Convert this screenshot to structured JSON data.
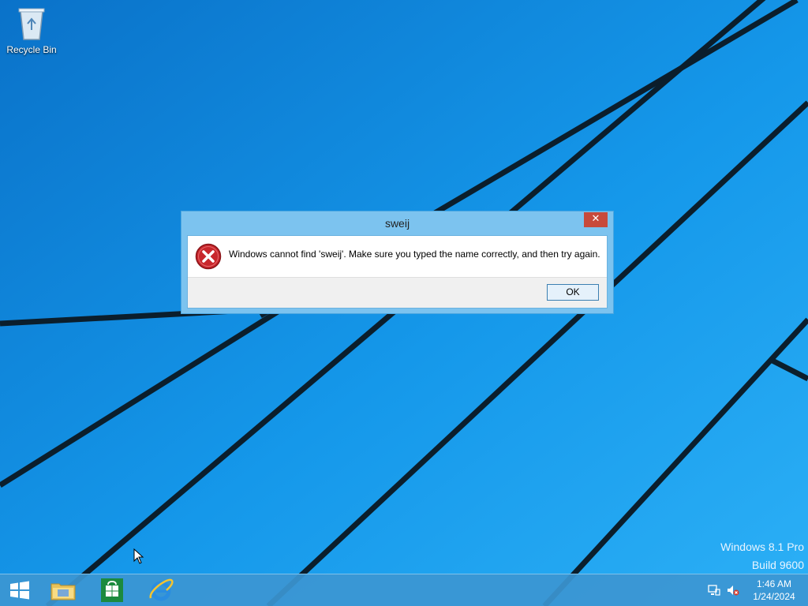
{
  "desktop": {
    "icons": [
      {
        "label": "Recycle Bin",
        "icon": "recycle-bin-icon"
      }
    ],
    "watermark": {
      "line1": "Windows 8.1 Pro",
      "line2": "Build 9600"
    }
  },
  "dialog": {
    "title": "sweij",
    "close_label": "✕",
    "icon": "error-icon",
    "message": "Windows cannot find 'sweij'. Make sure you typed the name correctly, and then try again.",
    "ok_label": "OK"
  },
  "taskbar": {
    "pinned": [
      {
        "name": "start",
        "icon": "windows-logo-icon"
      },
      {
        "name": "file-explorer",
        "icon": "folder-icon"
      },
      {
        "name": "store",
        "icon": "store-icon"
      },
      {
        "name": "internet-explorer",
        "icon": "ie-icon"
      }
    ],
    "tray": [
      {
        "icon": "network-icon"
      },
      {
        "icon": "volume-muted-icon"
      }
    ],
    "clock": {
      "time": "1:46 AM",
      "date": "1/24/2024"
    }
  },
  "colors": {
    "accent": "#1ea0ee",
    "dialog_frame": "#7cc3ef",
    "close_button": "#c74a3b",
    "error_red": "#c8272c"
  }
}
